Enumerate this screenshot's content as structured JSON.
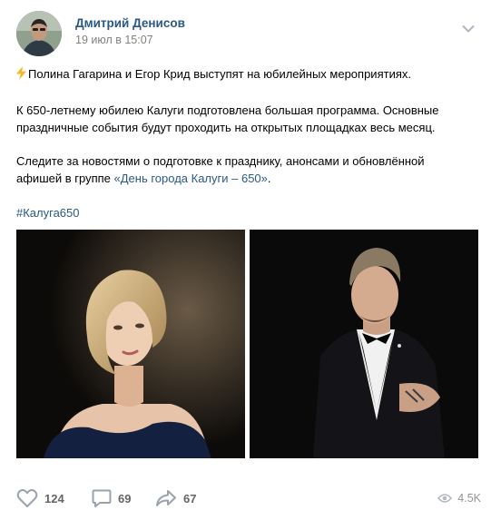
{
  "post": {
    "author": "Дмитрий Денисов",
    "date": "19 июл в 15:07",
    "line1": "Полина Гагарина и Егор Крид выступят на юбилейных мероприятиях.",
    "para2_line1": "К 650-летнему юбилею Калуги подготовлена большая программа. Основные",
    "para2_line2": "праздничные события будут проходить на открытых площадках весь месяц.",
    "para3_line1": "Следите за новостями о подготовке к празднику, анонсами и обновлённой",
    "para3_line2_prefix": "афишей в группе ",
    "para3_link": "«День города Калуги – 650»",
    "para3_suffix": ".",
    "hashtag": "#Калуга650"
  },
  "actions": {
    "likes": "124",
    "comments": "69",
    "shares": "67",
    "views": "4.5K"
  },
  "icons": {
    "bolt": "lightning-emoji-icon",
    "more": "chevron-down-icon",
    "like": "heart-icon",
    "comment": "comment-icon",
    "share": "share-arrow-icon",
    "views": "eye-icon"
  },
  "colors": {
    "link": "#2a5885",
    "secondary_text": "#828282",
    "action_icon": "#99a2ad"
  }
}
